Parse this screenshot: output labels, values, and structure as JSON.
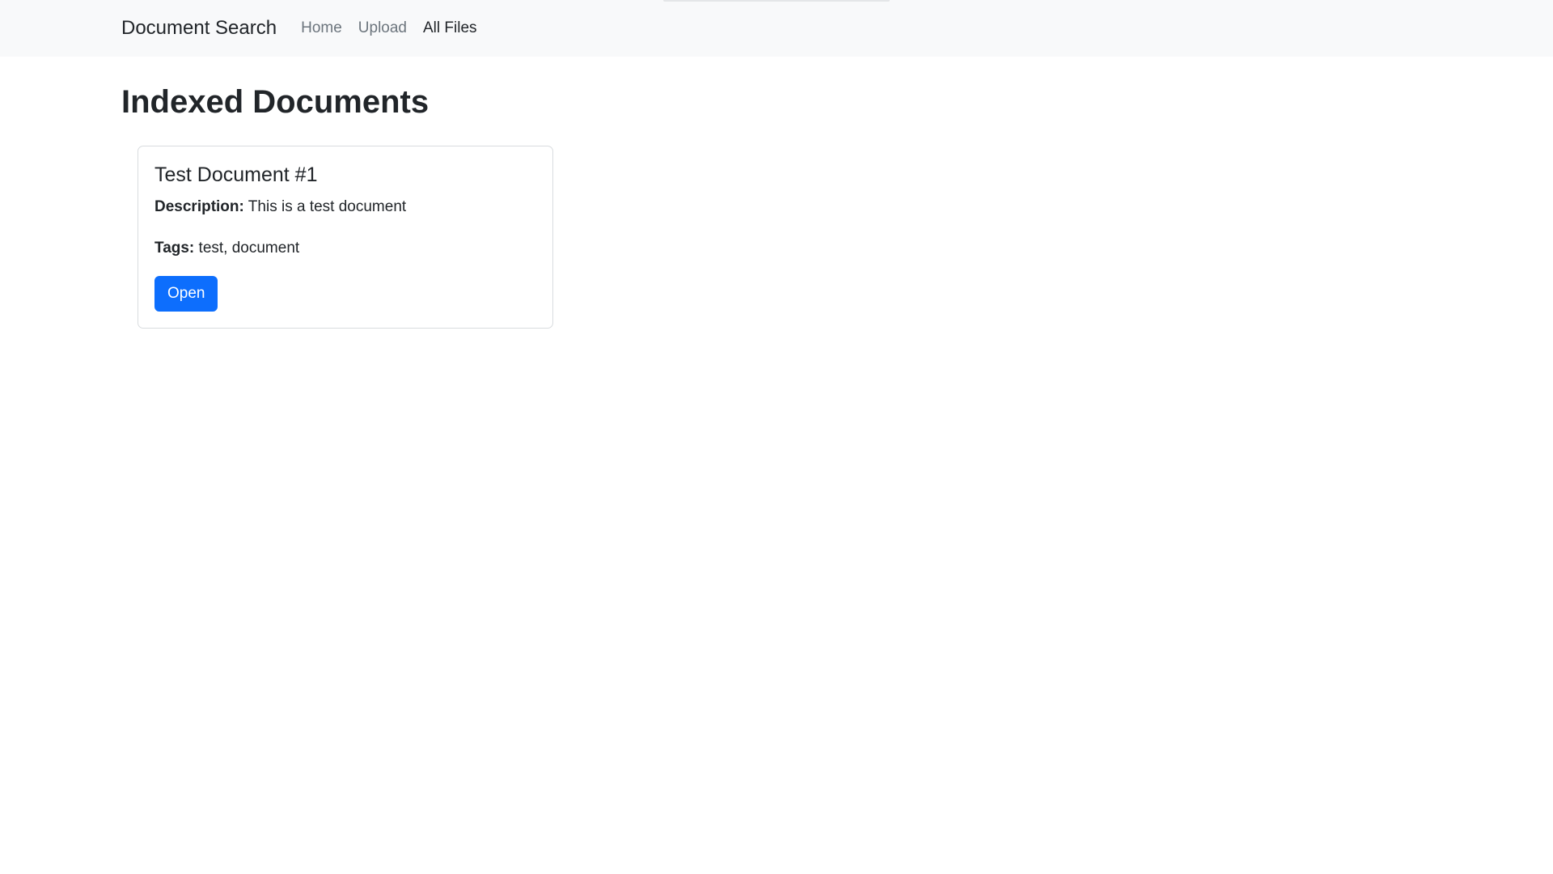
{
  "navbar": {
    "brand": "Document Search",
    "links": [
      {
        "label": "Home"
      },
      {
        "label": "Upload"
      },
      {
        "label": "All Files"
      }
    ]
  },
  "page": {
    "title": "Indexed Documents"
  },
  "documents": [
    {
      "title": "Test Document #1",
      "description_label": "Description:",
      "description": "This is a test document",
      "tags_label": "Tags:",
      "tags": "test, document",
      "open_label": "Open"
    }
  ],
  "colors": {
    "navbar_bg": "#f8f9fa",
    "primary": "#0d6efd",
    "text": "#212529",
    "muted": "#6c757d"
  }
}
